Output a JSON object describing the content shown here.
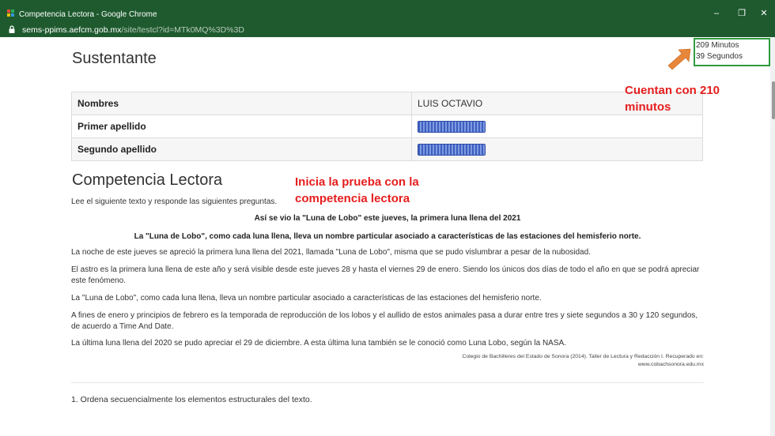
{
  "window": {
    "title": "Competencia Lectora - Google Chrome",
    "url_host": "sems-ppims.aefcm.gob.mx",
    "url_path": "/site/testcl?id=MTk0MQ%3D%3D",
    "controls": {
      "minimize": "–",
      "maximize": "❐",
      "close": "✕"
    }
  },
  "sustentante": {
    "heading": "Sustentante",
    "rows": [
      {
        "label": "Nombres",
        "value": "LUIS OCTAVIO",
        "redacted": false
      },
      {
        "label": "Primer apellido",
        "value": "",
        "redacted": true
      },
      {
        "label": "Segundo apellido",
        "value": "",
        "redacted": true
      }
    ]
  },
  "timer": {
    "minutes": "209 Minutos",
    "seconds": "39 Segundos"
  },
  "competencia": {
    "heading": "Competencia Lectora",
    "intro": "Lee el siguiente texto y responde las siguientes preguntas.",
    "title1": "Así se vio la \"Luna de Lobo\" este jueves, la primera luna llena del 2021",
    "title2": "La \"Luna de Lobo\", como cada luna llena, lleva un nombre particular asociado a características de las estaciones del hemisferio norte.",
    "paragraphs": [
      "La noche de este jueves se apreció la primera luna llena del 2021, llamada \"Luna de Lobo\", misma que se pudo vislumbrar a pesar de la nubosidad.",
      "El astro es la primera luna llena de este año y será visible desde este jueves 28 y hasta el viernes 29 de enero. Siendo los únicos dos días de todo el año en que se podrá apreciar este fenómeno.",
      "La \"Luna de Lobo\", como cada luna llena, lleva un nombre particular asociado a características de las estaciones del hemisferio norte.",
      "A fines de enero y principios de febrero es la temporada de reproducción de los lobos y el aullido de estos animales pasa a durar entre tres y siete segundos a 30 y 120 segundos, de acuerdo a Time And Date.",
      "La última luna llena del 2020 se pudo apreciar el 29 de diciembre. A esta última luna también se le conoció como Luna Lobo, según la NASA."
    ],
    "citation_line1": "Colegio de Bachilleres del Estado de Sonora (2014). Taller de Lectura y Redacción I. Recuperado en:",
    "citation_line2": "www.cobachsonora.edu.mx",
    "question1": "1. Ordena secuencialmente los elementos estructurales del texto."
  },
  "annotations": {
    "minutes_note": "Cuentan con 210 minutos",
    "start_note": "Inicia la prueba con la competencia lectora",
    "color": "#e61e1e",
    "arrow_color": "#e8873a"
  },
  "colors": {
    "chrome_frame": "#1e5a2e",
    "timer_border": "#2e9b3e"
  },
  "icons": {
    "app": "chrome-app-icon",
    "lock": "lock-icon",
    "arrow": "arrow-up-right-icon"
  }
}
